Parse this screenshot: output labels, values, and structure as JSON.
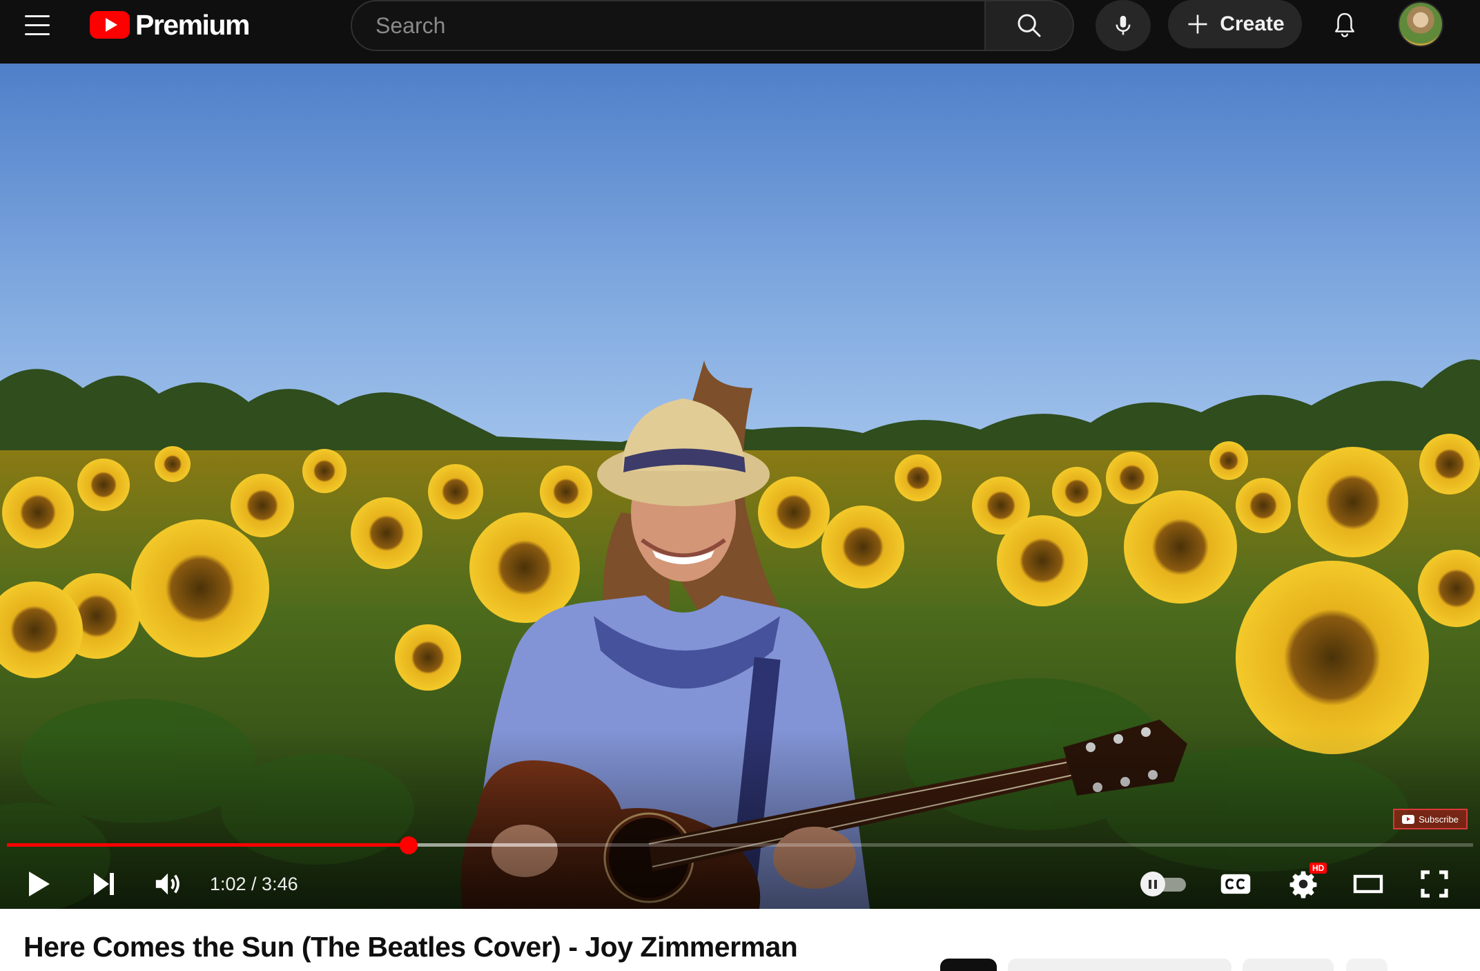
{
  "header": {
    "logo_text": "Premium",
    "search": {
      "placeholder": "Search",
      "value": ""
    },
    "create_label": "Create",
    "icons": {
      "menu": "hamburger-menu-icon",
      "search": "search-icon",
      "mic": "microphone-icon",
      "create": "plus-icon",
      "notifications": "bell-icon"
    },
    "colors": {
      "background": "#0f0f0f",
      "brand": "#ff0000"
    }
  },
  "player": {
    "current_time": "1:02",
    "duration": "3:46",
    "time_display": "1:02 / 3:46",
    "progress_fraction": 0.274,
    "buffered_fraction": 0.375,
    "quality_badge": "HD",
    "watermark_label": "Subscribe",
    "controls": [
      "play-icon",
      "next-icon",
      "volume-icon",
      "autoplay-toggle",
      "captions-icon",
      "settings-icon",
      "theater-mode-icon",
      "fullscreen-icon"
    ],
    "accent_color": "#ff0000"
  },
  "video": {
    "title": "Here Comes the Sun (The Beatles Cover) - Joy Zimmerman"
  }
}
